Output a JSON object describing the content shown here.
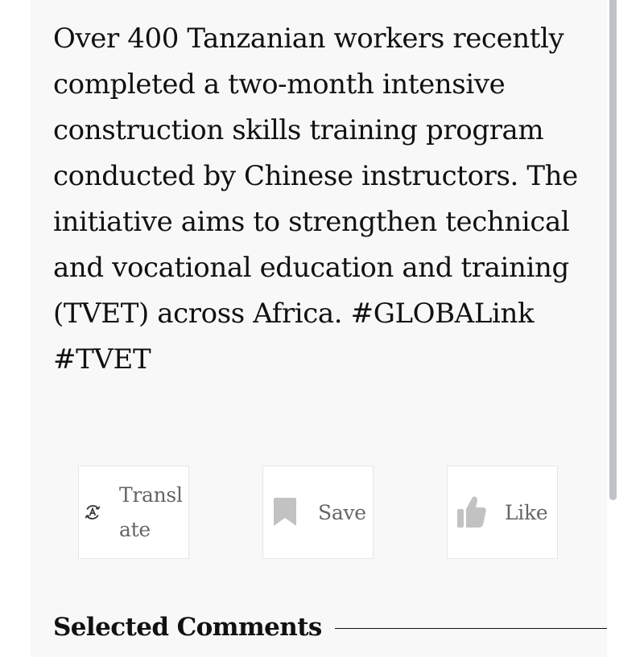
{
  "article": {
    "text": "Over 400 Tanzanian workers recently completed a two-month intensive construction skills training program conducted by Chinese instructors. The initiative aims to strengthen technical and vocational education and training (TVET) across Africa. #GLOBALink #TVET"
  },
  "actions": {
    "translate": {
      "label": "Translate",
      "icon": "translate-icon"
    },
    "save": {
      "label": "Save",
      "icon": "bookmark-icon"
    },
    "like": {
      "label": "Like",
      "icon": "thumbs-up-icon"
    }
  },
  "comments": {
    "title": "Selected Comments"
  },
  "colors": {
    "panel_background": "#f8f8f8",
    "text": "#111111",
    "icon_gray": "#c2c2c2",
    "label_gray": "#666666",
    "scrollbar_thumb": "#c1c1c8"
  }
}
